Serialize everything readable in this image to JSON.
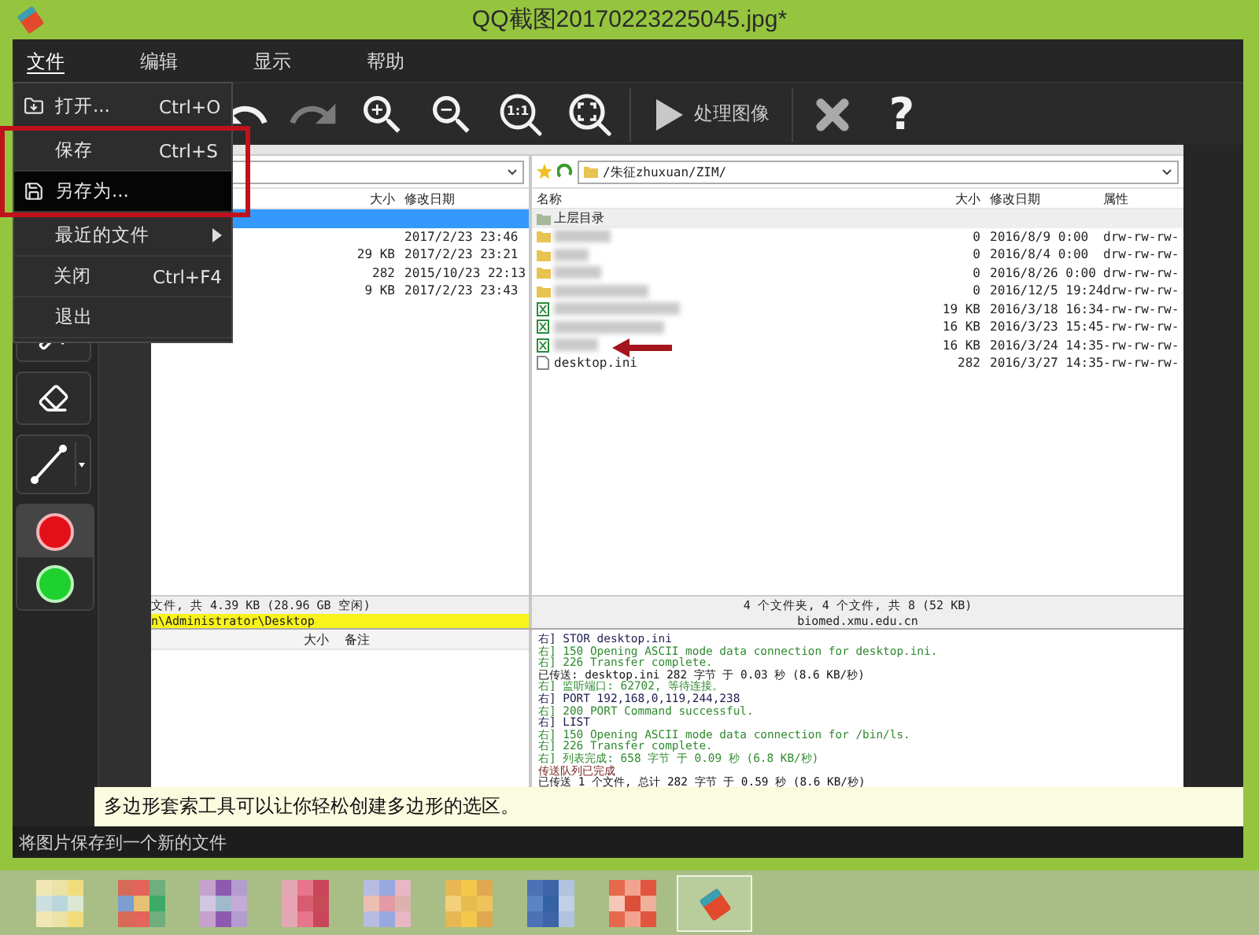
{
  "window": {
    "title": "QQ截图20170223225045.jpg*"
  },
  "menu_bar": [
    {
      "label": "文件",
      "selected": true
    },
    {
      "label": "编辑",
      "selected": false
    },
    {
      "label": "显示",
      "selected": false
    },
    {
      "label": "帮助",
      "selected": false
    }
  ],
  "file_menu": [
    {
      "kind": "open",
      "label": "打开...",
      "shortcut": "Ctrl+O",
      "selected": false
    },
    {
      "kind": "plain",
      "label": "保存",
      "shortcut": "Ctrl+S",
      "selected": false
    },
    {
      "kind": "save_as",
      "label": "另存为...",
      "selected": true
    },
    {
      "kind": "submenu",
      "label": "最近的文件",
      "selected": false
    },
    {
      "kind": "plain",
      "label": "关闭",
      "shortcut": "Ctrl+F4",
      "selected": false
    },
    {
      "kind": "plain",
      "label": "退出",
      "selected": false
    }
  ],
  "toolbar": [
    {
      "kind": "undo",
      "disabled": false
    },
    {
      "kind": "redo",
      "disabled": true
    },
    {
      "kind": "zoom_in",
      "disabled": false
    },
    {
      "kind": "zoom_out",
      "disabled": false
    },
    {
      "kind": "actual_size",
      "label": "1:1",
      "disabled": false
    },
    {
      "kind": "fit",
      "disabled": false
    },
    {
      "kind": "separator"
    },
    {
      "kind": "process",
      "label": "处理图像",
      "disabled": false
    },
    {
      "kind": "separator"
    },
    {
      "kind": "close",
      "disabled": false
    },
    {
      "kind": "help",
      "label": "?",
      "disabled": false
    }
  ],
  "tools": [
    {
      "kind": "wand"
    },
    {
      "kind": "eraser"
    },
    {
      "kind": "line"
    }
  ],
  "color_swatches": [
    {
      "color": "#e3101a",
      "selected": true
    },
    {
      "color": "#1ed12e",
      "selected": false
    }
  ],
  "screenshot": {
    "local": {
      "columns": [
        "大小",
        "修改日期"
      ],
      "rows": [
        {
          "selected": true
        },
        {
          "date": "2017/2/23 23:46",
          "selected": false
        },
        {
          "size": "29 KB",
          "date": "2017/2/23 23:21",
          "selected": false
        },
        {
          "size": "282",
          "date": "2015/10/23 22:13",
          "selected": false
        },
        {
          "size": "9 KB",
          "date": "2017/2/23 23:43",
          "selected": false
        }
      ],
      "summary": "文件, 共 4.39 KB (28.96 GB 空闲)",
      "path": "n\\Administrator\\Desktop",
      "queue_columns": [
        "大小",
        "备注"
      ]
    },
    "remote": {
      "path": "/朱征zhuxuan/ZIM/",
      "columns": [
        "名称",
        "大小",
        "修改日期",
        "属性"
      ],
      "rows": [
        {
          "kind": "up",
          "name": "上层目录"
        },
        {
          "kind": "folder",
          "size": "0",
          "date": "2016/8/9 0:00",
          "attr": "drw-rw-rw-"
        },
        {
          "kind": "folder",
          "size": "0",
          "date": "2016/8/4 0:00",
          "attr": "drw-rw-rw-"
        },
        {
          "kind": "folder",
          "size": "0",
          "date": "2016/8/26 0:00",
          "attr": "drw-rw-rw-"
        },
        {
          "kind": "folder",
          "size": "0",
          "date": "2016/12/5 19:24",
          "attr": "drw-rw-rw-"
        },
        {
          "kind": "sheet",
          "size": "19 KB",
          "date": "2016/3/18 16:34",
          "attr": "-rw-rw-rw-"
        },
        {
          "kind": "sheet",
          "size": "16 KB",
          "date": "2016/3/23 15:45",
          "attr": "-rw-rw-rw-"
        },
        {
          "kind": "sheet",
          "size": "16 KB",
          "date": "2016/3/24 14:35",
          "attr": "-rw-rw-rw-"
        },
        {
          "kind": "file",
          "name": "desktop.ini",
          "size": "282",
          "date": "2016/3/27 14:35",
          "attr": "-rw-rw-rw-"
        }
      ],
      "summary": "4 个文件夹, 4 个文件, 共 8 (52 KB)",
      "host": "biomed.xmu.edu.cn"
    },
    "log": [
      {
        "kind": "command",
        "text": "右] STOR desktop.ini"
      },
      {
        "kind": "response",
        "text": "右] 150 Opening ASCII mode data connection for desktop.ini."
      },
      {
        "kind": "response",
        "text": "右] 226 Transfer complete."
      },
      {
        "kind": "status",
        "text": "已传送: desktop.ini 282 字节 于 0.03 秒 (8.6 KB/秒)"
      },
      {
        "kind": "response",
        "text": "右] 监听端口: 62702, 等待连接。"
      },
      {
        "kind": "command",
        "text": "右] PORT 192,168,0,119,244,238"
      },
      {
        "kind": "response",
        "text": "右] 200 PORT Command successful."
      },
      {
        "kind": "command",
        "text": "右] LIST"
      },
      {
        "kind": "response",
        "text": "右] 150 Opening ASCII mode data connection for /bin/ls."
      },
      {
        "kind": "response",
        "text": "右] 226 Transfer complete."
      },
      {
        "kind": "response",
        "text": "右] 列表完成: 658 字节 于 0.09 秒 (6.8 KB/秒)"
      },
      {
        "kind": "done",
        "text": "传送队列已完成"
      },
      {
        "kind": "status",
        "text": "已传送 1 个文件, 总计 282 字节 于 0.59 秒 (8.6 KB/秒)"
      }
    ]
  },
  "hint": "多边形套索工具可以让你轻松创建多边形的选区。",
  "status_bar": "将图片保存到一个新的文件",
  "taskbar": [
    {
      "kind": "blurred",
      "selected": false
    },
    {
      "kind": "blurred",
      "selected": false
    },
    {
      "kind": "blurred",
      "selected": false
    },
    {
      "kind": "blurred",
      "selected": false
    },
    {
      "kind": "blurred",
      "selected": false
    },
    {
      "kind": "blurred",
      "selected": false
    },
    {
      "kind": "blurred",
      "selected": false
    },
    {
      "kind": "blurred",
      "selected": false
    },
    {
      "kind": "app",
      "selected": true
    }
  ]
}
